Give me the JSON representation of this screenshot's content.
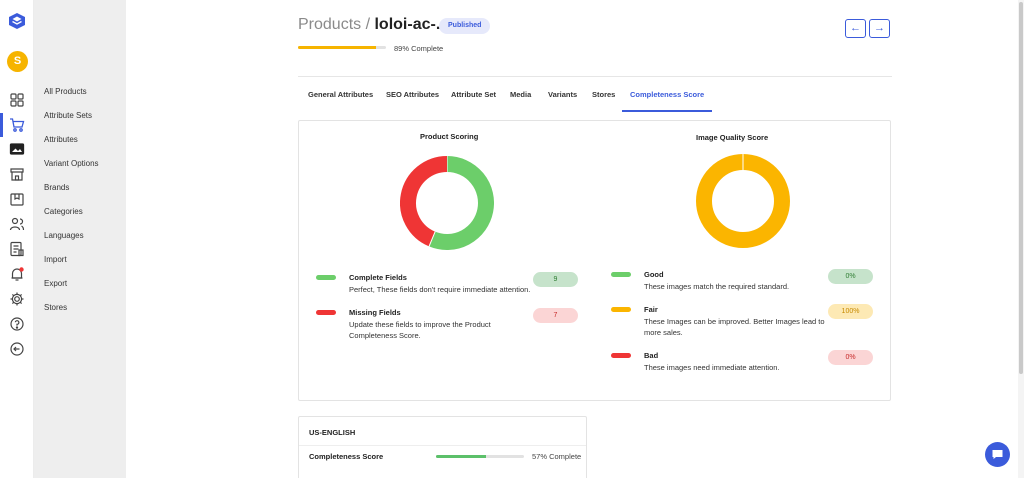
{
  "user": {
    "initial": "S"
  },
  "icons": [
    "dashboard-icon",
    "cart-icon",
    "image-icon",
    "store-icon",
    "box-icon",
    "users-icon",
    "report-icon",
    "bell-icon",
    "settings-icon",
    "help-icon",
    "logout-icon"
  ],
  "nav": {
    "items": [
      "All Products",
      "Attribute Sets",
      "Attributes",
      "Variant Options",
      "Brands",
      "Categories",
      "Languages",
      "Import",
      "Export",
      "Stores"
    ]
  },
  "header": {
    "breadcrumb_parent": "Products /",
    "title": "loloi-ac-...",
    "status": "Published",
    "progress_percent": 89,
    "progress_text": "89% Complete",
    "prev_icon": "←",
    "next_icon": "→"
  },
  "tabs": [
    "General Attributes",
    "SEO Attributes",
    "Attribute Set",
    "Media",
    "Variants",
    "Stores",
    "Completeness Score"
  ],
  "active_tab": 6,
  "colors": {
    "accent": "#3b5bdb",
    "green": "#6cce6a",
    "red": "#ef3535",
    "yellow": "#fbb500"
  },
  "product_scoring": {
    "title": "Product Scoring",
    "legend": [
      {
        "title": "Complete Fields",
        "desc": "Perfect, These fields don't require immediate attention.",
        "value": "9"
      },
      {
        "title": "Missing Fields",
        "desc": "Update these fields to improve the Product Completeness Score.",
        "value": "7"
      }
    ]
  },
  "image_quality": {
    "title": "Image Quality Score",
    "legend": [
      {
        "title": "Good",
        "desc": "These images match the required standard.",
        "value": "0%"
      },
      {
        "title": "Fair",
        "desc": "These Images can be improved. Better Images lead to more sales.",
        "value": "100%"
      },
      {
        "title": "Bad",
        "desc": "These images need immediate attention.",
        "value": "0%"
      }
    ]
  },
  "chart_data": [
    {
      "type": "pie",
      "title": "Product Scoring",
      "categories": [
        "Complete Fields",
        "Missing Fields"
      ],
      "values": [
        9,
        7
      ],
      "colors": [
        "#6cce6a",
        "#ef3535"
      ]
    },
    {
      "type": "pie",
      "title": "Image Quality Score",
      "categories": [
        "Good",
        "Fair",
        "Bad"
      ],
      "values": [
        0,
        100,
        0
      ],
      "colors": [
        "#6cce6a",
        "#fbb500",
        "#ef3535"
      ]
    }
  ],
  "language_card": {
    "language": "US-ENGLISH",
    "label": "Completeness Score",
    "percent": 57,
    "text": "57% Complete"
  }
}
